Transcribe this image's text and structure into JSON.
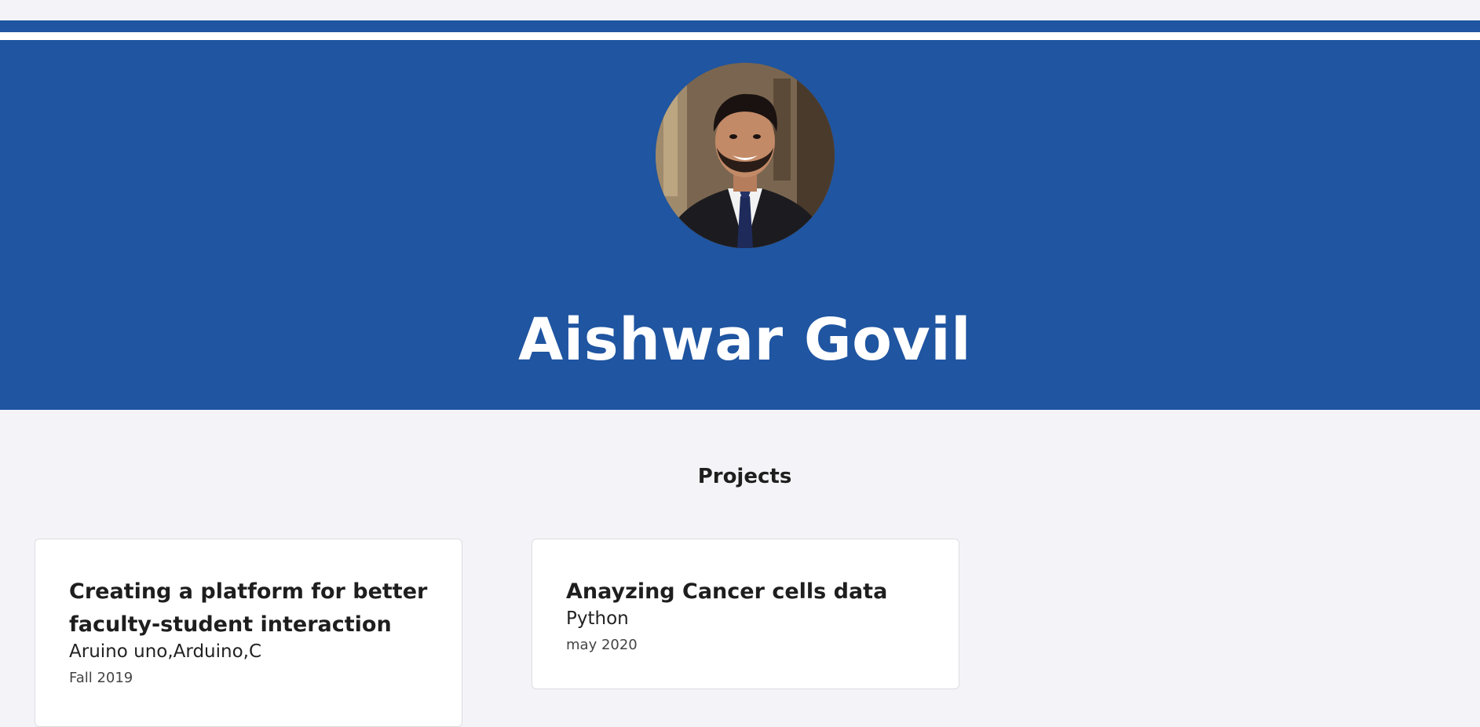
{
  "profile": {
    "name": "Aishwar Govil"
  },
  "projects": {
    "heading": "Projects",
    "items": [
      {
        "title": "Creating a platform for better faculty-student interaction",
        "tech": "Aruino uno,Arduino,C",
        "date": "Fall 2019"
      },
      {
        "title": "Anayzing Cancer cells data",
        "tech": "Python",
        "date": "may 2020"
      }
    ]
  },
  "theme": {
    "primary": "#1f55a1",
    "background": "#f4f4f8",
    "card": "#ffffff"
  }
}
